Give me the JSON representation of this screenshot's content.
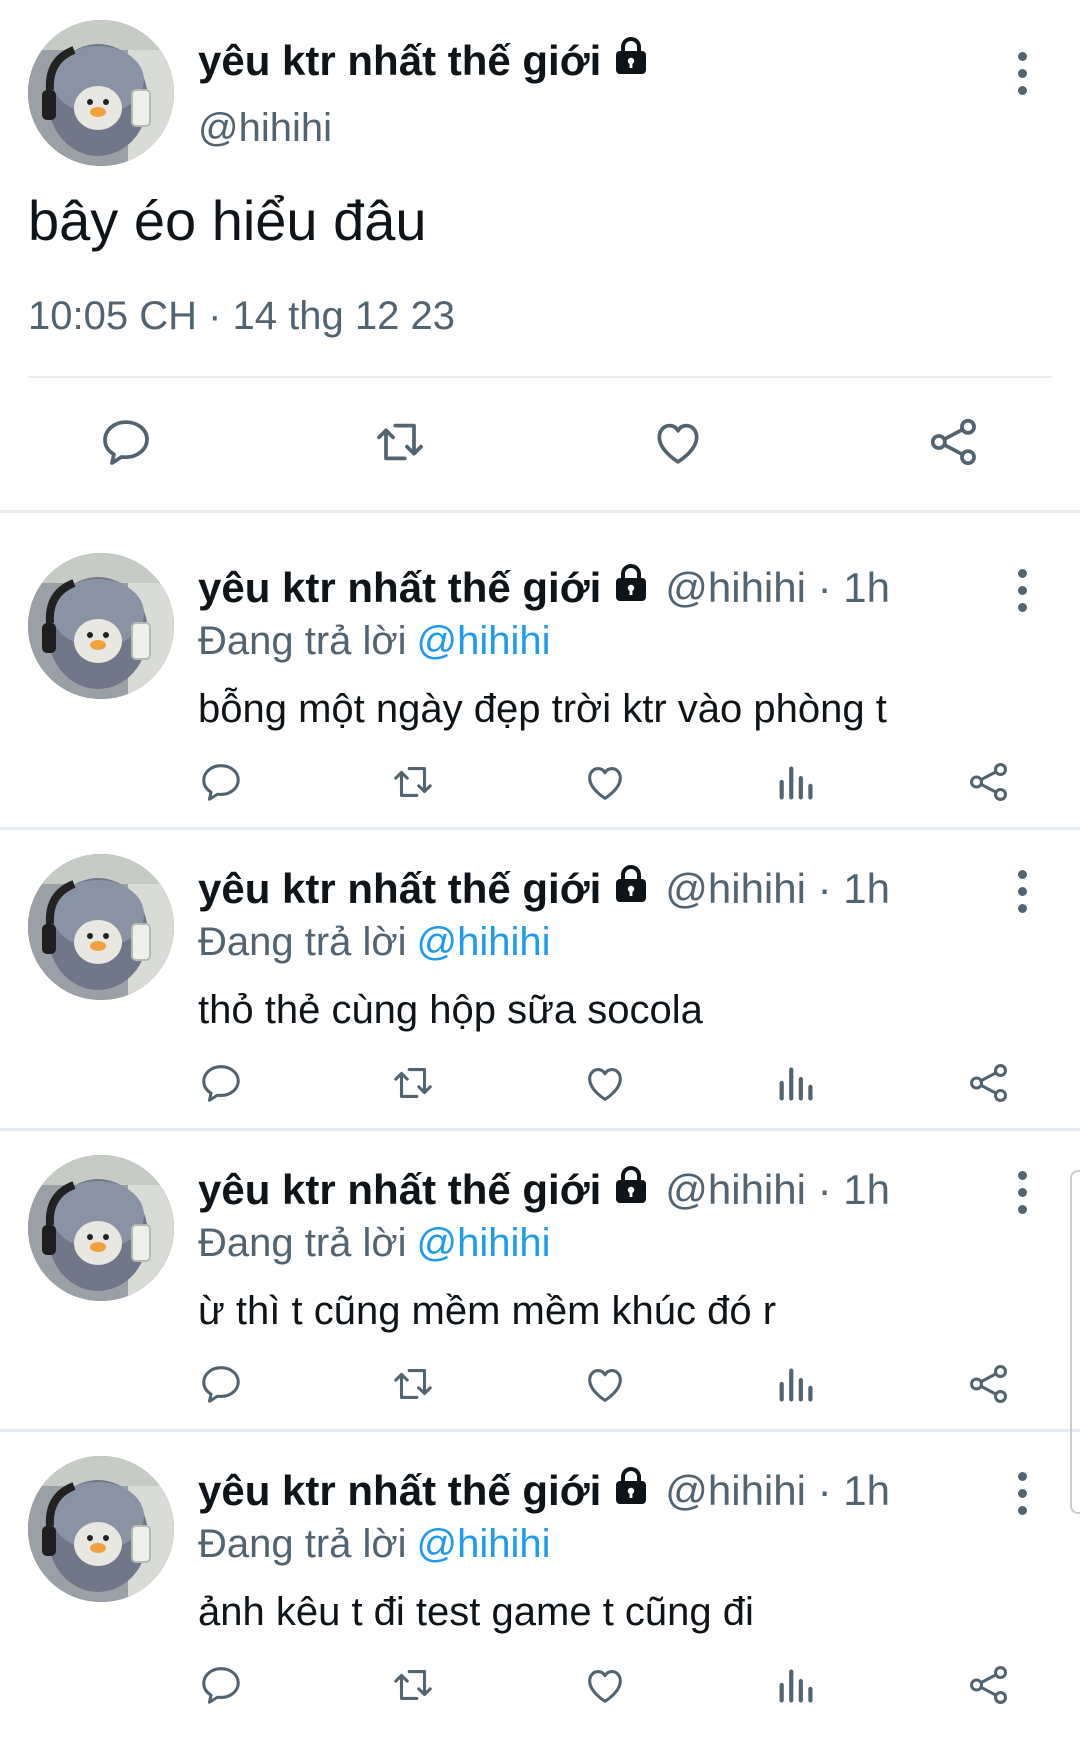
{
  "main_tweet": {
    "display_name": "yêu ktr nhất thế giới",
    "handle": "@hihihi",
    "text": "bây éo hiểu đâu",
    "timestamp": "10:05 CH · 14 thg 12 23",
    "actions": [
      "reply-icon",
      "retweet-icon",
      "like-icon",
      "share-icon"
    ]
  },
  "replies": [
    {
      "display_name": "yêu ktr nhất thế giới",
      "handle_time": "@hihihi · 1h",
      "replying_label": "Đang trả lời",
      "replying_to": "@hihihi",
      "text": "bỗng một ngày đẹp trời ktr vào phòng t"
    },
    {
      "display_name": "yêu ktr nhất thế giới",
      "handle_time": "@hihihi · 1h",
      "replying_label": "Đang trả lời",
      "replying_to": "@hihihi",
      "text": "thỏ thẻ cùng hộp sữa socola"
    },
    {
      "display_name": "yêu ktr nhất thế giới",
      "handle_time": "@hihihi · 1h",
      "replying_label": "Đang trả lời",
      "replying_to": "@hihihi",
      "text": "ừ thì t cũng mềm mềm khúc đó r"
    },
    {
      "display_name": "yêu ktr nhất thế giới",
      "handle_time": "@hihihi · 1h",
      "replying_label": "Đang trả lời",
      "replying_to": "@hihihi",
      "text": "ảnh kêu t đi test game t cũng đi"
    }
  ],
  "colors": {
    "text": "#0f1419",
    "secondary": "#536471",
    "mention": "#1d9bf0",
    "divider": "#e6ecf0"
  }
}
